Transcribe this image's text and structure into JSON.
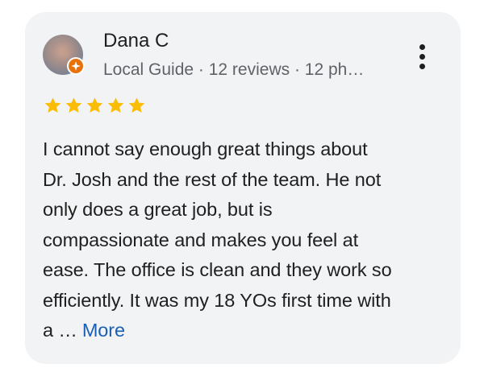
{
  "review": {
    "reviewer": {
      "name": "Dana C",
      "meta": "Local Guide · 12 reviews · 12 ph…",
      "avatar_icon": "user-avatar",
      "badge_icon": "local-guide-badge-icon",
      "badge_color": "#e8710a"
    },
    "rating": {
      "value": 5,
      "max": 5,
      "star_color": "#fbbc04",
      "icon": "star-icon"
    },
    "text_lines": [
      "I cannot say enough great things about",
      "Dr. Josh and the rest of the team. He not",
      "only does a great job, but is",
      "compassionate and makes you feel at",
      "ease. The office is clean and they work so",
      "efficiently. It was my 18 YOs first time with",
      "a …"
    ],
    "more_label": "More",
    "more_options_icon": "more-vert-icon"
  },
  "colors": {
    "card_background": "#f2f3f5",
    "link": "#1a5fb4",
    "secondary_text": "#5f6368"
  }
}
